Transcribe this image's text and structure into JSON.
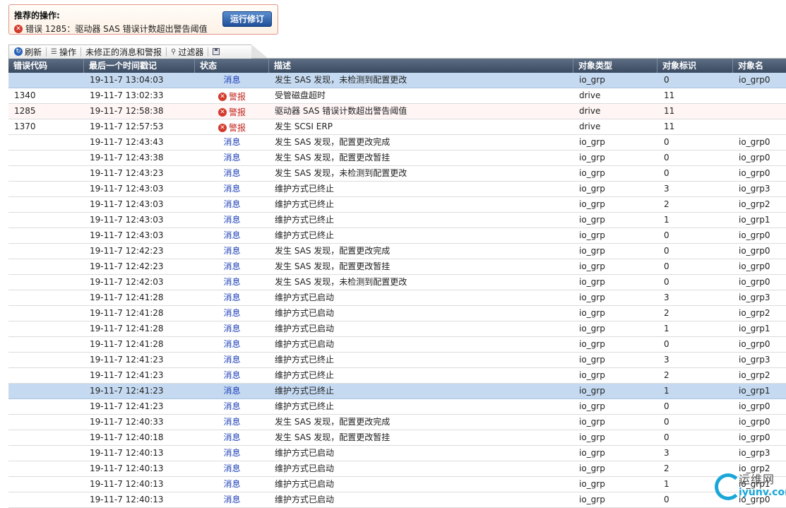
{
  "recommend": {
    "title": "推荐的操作:",
    "message": "错误 1285：驱动器 SAS 错误计数超出警告阈值",
    "run_button": "运行修订"
  },
  "toolbar": {
    "refresh": "刷新",
    "actions": "操作",
    "unfixed": "未修正的消息和警报",
    "filter": "过滤器"
  },
  "grid": {
    "headers": [
      "错误代码",
      "最后一个时间戳记",
      "状态",
      "描述",
      "对象类型",
      "对象标识",
      "对象名"
    ],
    "rows": [
      {
        "code": "",
        "time": "19-11-7 13:04:03",
        "status": "消息",
        "desc": "发生 SAS 发现，未检测到配置更改",
        "type": "io_grp",
        "id": "0",
        "name": "io_grp0",
        "selected": true
      },
      {
        "code": "1340",
        "time": "19-11-7 13:02:33",
        "status": "警报",
        "desc": "受管磁盘超时",
        "type": "drive",
        "id": "11",
        "name": ""
      },
      {
        "code": "1285",
        "time": "19-11-7 12:58:38",
        "status": "警报",
        "desc": "驱动器 SAS 错误计数超出警告阈值",
        "type": "drive",
        "id": "11",
        "name": "",
        "alert": true
      },
      {
        "code": "1370",
        "time": "19-11-7 12:57:53",
        "status": "警报",
        "desc": "发生 SCSI ERP",
        "type": "drive",
        "id": "11",
        "name": ""
      },
      {
        "code": "",
        "time": "19-11-7 12:43:43",
        "status": "消息",
        "desc": "发生 SAS 发现，配置更改完成",
        "type": "io_grp",
        "id": "0",
        "name": "io_grp0"
      },
      {
        "code": "",
        "time": "19-11-7 12:43:38",
        "status": "消息",
        "desc": "发生 SAS 发现，配置更改暂挂",
        "type": "io_grp",
        "id": "0",
        "name": "io_grp0"
      },
      {
        "code": "",
        "time": "19-11-7 12:43:23",
        "status": "消息",
        "desc": "发生 SAS 发现，未检测到配置更改",
        "type": "io_grp",
        "id": "0",
        "name": "io_grp0"
      },
      {
        "code": "",
        "time": "19-11-7 12:43:03",
        "status": "消息",
        "desc": "维护方式已终止",
        "type": "io_grp",
        "id": "3",
        "name": "io_grp3"
      },
      {
        "code": "",
        "time": "19-11-7 12:43:03",
        "status": "消息",
        "desc": "维护方式已终止",
        "type": "io_grp",
        "id": "2",
        "name": "io_grp2"
      },
      {
        "code": "",
        "time": "19-11-7 12:43:03",
        "status": "消息",
        "desc": "维护方式已终止",
        "type": "io_grp",
        "id": "1",
        "name": "io_grp1"
      },
      {
        "code": "",
        "time": "19-11-7 12:43:03",
        "status": "消息",
        "desc": "维护方式已终止",
        "type": "io_grp",
        "id": "0",
        "name": "io_grp0"
      },
      {
        "code": "",
        "time": "19-11-7 12:42:23",
        "status": "消息",
        "desc": "发生 SAS 发现，配置更改完成",
        "type": "io_grp",
        "id": "0",
        "name": "io_grp0"
      },
      {
        "code": "",
        "time": "19-11-7 12:42:23",
        "status": "消息",
        "desc": "发生 SAS 发现，配置更改暂挂",
        "type": "io_grp",
        "id": "0",
        "name": "io_grp0"
      },
      {
        "code": "",
        "time": "19-11-7 12:42:03",
        "status": "消息",
        "desc": "发生 SAS 发现，未检测到配置更改",
        "type": "io_grp",
        "id": "0",
        "name": "io_grp0"
      },
      {
        "code": "",
        "time": "19-11-7 12:41:28",
        "status": "消息",
        "desc": "维护方式已启动",
        "type": "io_grp",
        "id": "3",
        "name": "io_grp3"
      },
      {
        "code": "",
        "time": "19-11-7 12:41:28",
        "status": "消息",
        "desc": "维护方式已启动",
        "type": "io_grp",
        "id": "2",
        "name": "io_grp2"
      },
      {
        "code": "",
        "time": "19-11-7 12:41:28",
        "status": "消息",
        "desc": "维护方式已启动",
        "type": "io_grp",
        "id": "1",
        "name": "io_grp1"
      },
      {
        "code": "",
        "time": "19-11-7 12:41:28",
        "status": "消息",
        "desc": "维护方式已启动",
        "type": "io_grp",
        "id": "0",
        "name": "io_grp0"
      },
      {
        "code": "",
        "time": "19-11-7 12:41:23",
        "status": "消息",
        "desc": "维护方式已终止",
        "type": "io_grp",
        "id": "3",
        "name": "io_grp3"
      },
      {
        "code": "",
        "time": "19-11-7 12:41:23",
        "status": "消息",
        "desc": "维护方式已终止",
        "type": "io_grp",
        "id": "2",
        "name": "io_grp2"
      },
      {
        "code": "",
        "time": "19-11-7 12:41:23",
        "status": "消息",
        "desc": "维护方式已终止",
        "type": "io_grp",
        "id": "1",
        "name": "io_grp1",
        "selected": true
      },
      {
        "code": "",
        "time": "19-11-7 12:41:23",
        "status": "消息",
        "desc": "维护方式已终止",
        "type": "io_grp",
        "id": "0",
        "name": "io_grp0"
      },
      {
        "code": "",
        "time": "19-11-7 12:40:33",
        "status": "消息",
        "desc": "发生 SAS 发现，配置更改完成",
        "type": "io_grp",
        "id": "0",
        "name": "io_grp0"
      },
      {
        "code": "",
        "time": "19-11-7 12:40:18",
        "status": "消息",
        "desc": "发生 SAS 发现，配置更改暂挂",
        "type": "io_grp",
        "id": "0",
        "name": "io_grp0"
      },
      {
        "code": "",
        "time": "19-11-7 12:40:13",
        "status": "消息",
        "desc": "维护方式已启动",
        "type": "io_grp",
        "id": "3",
        "name": "io_grp3"
      },
      {
        "code": "",
        "time": "19-11-7 12:40:13",
        "status": "消息",
        "desc": "维护方式已启动",
        "type": "io_grp",
        "id": "2",
        "name": "io_grp2"
      },
      {
        "code": "",
        "time": "19-11-7 12:40:13",
        "status": "消息",
        "desc": "维护方式已启动",
        "type": "io_grp",
        "id": "1",
        "name": "io_grp1"
      },
      {
        "code": "",
        "time": "19-11-7 12:40:13",
        "status": "消息",
        "desc": "维护方式已启动",
        "type": "io_grp",
        "id": "0",
        "name": "io_grp0"
      }
    ]
  },
  "watermark": {
    "cn": "运维网",
    "en": "iyunv.com"
  },
  "colors": {
    "header_bg": "#3a4a60",
    "selected_row": "#c5daf1",
    "alert_text": "#c0261f",
    "message_text": "#1d3fb8",
    "run_button": "#1f4f97"
  },
  "icons": {
    "refresh": "refresh-icon",
    "actions": "list-icon",
    "filter": "magnifier-icon",
    "save": "save-icon",
    "error": "error-icon"
  }
}
